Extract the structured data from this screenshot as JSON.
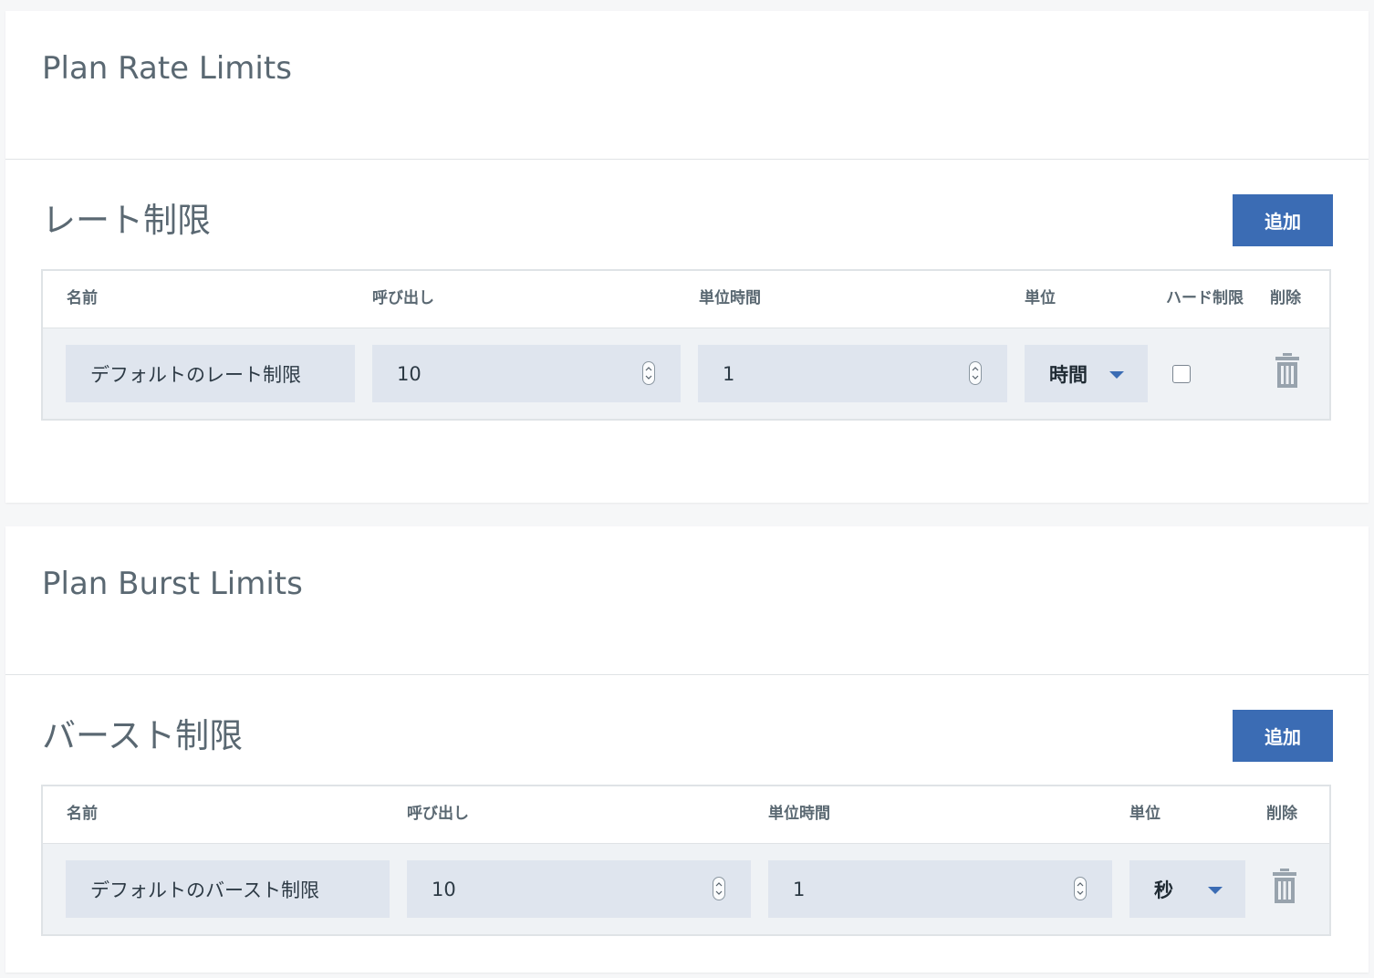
{
  "rate_card": {
    "title": "Plan Rate Limits",
    "section_title": "レート制限",
    "add_label": "追加",
    "headers": {
      "name": "名前",
      "calls": "呼び出し",
      "interval": "単位時間",
      "unit": "単位",
      "hard_limit": "ハード制限",
      "delete": "削除"
    },
    "row": {
      "name": "デフォルトのレート制限",
      "calls": "10",
      "interval": "1",
      "unit": "時間",
      "hard_limit_checked": false
    }
  },
  "burst_card": {
    "title": "Plan Burst Limits",
    "section_title": "バースト制限",
    "add_label": "追加",
    "headers": {
      "name": "名前",
      "calls": "呼び出し",
      "interval": "単位時間",
      "unit": "単位",
      "delete": "削除"
    },
    "row": {
      "name": "デフォルトのバースト制限",
      "calls": "10",
      "interval": "1",
      "unit": "秒"
    }
  },
  "icons": {
    "delete": "trash-icon",
    "stepper": "stepper-icon",
    "dropdown": "caret-down-icon"
  },
  "colors": {
    "accent": "#3b6cb4",
    "field_bg": "#dfe5ee",
    "row_bg": "#eff2f5",
    "border": "#dfe3e6",
    "title_text": "#5a6872"
  }
}
